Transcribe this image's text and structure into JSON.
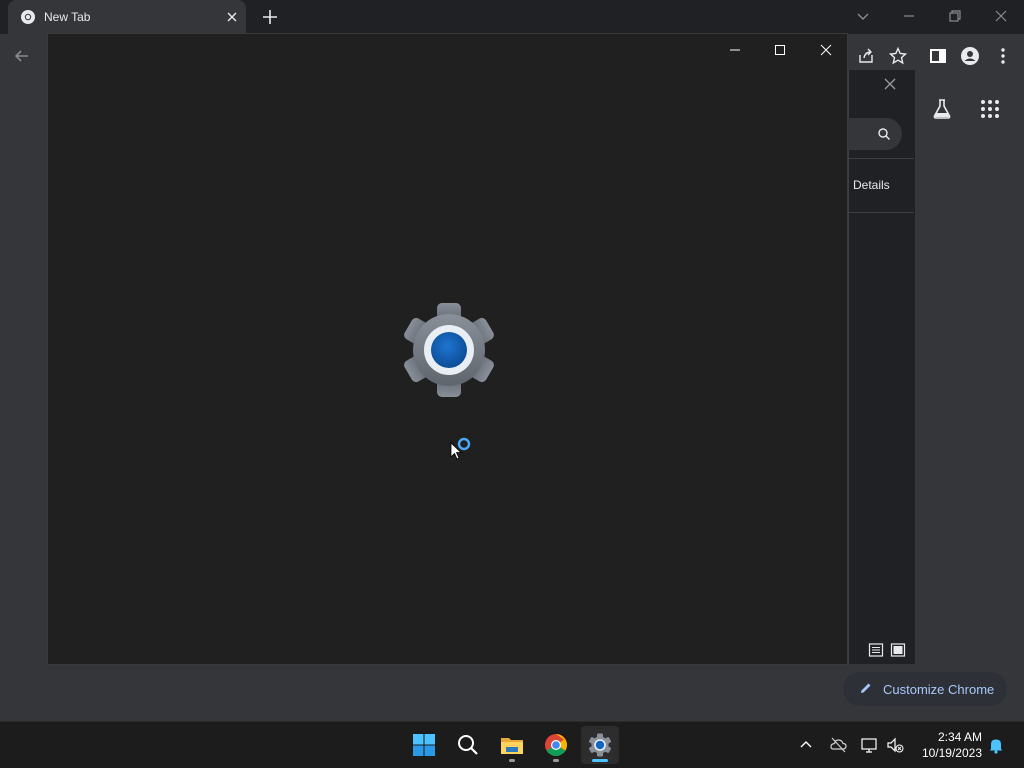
{
  "browser": {
    "tab_title": "New Tab",
    "side_panel": {
      "details_label": "Details"
    },
    "customize_label": "Customize Chrome"
  },
  "taskbar": {
    "apps": [
      {
        "name": "Start",
        "icon": "windows-start-icon"
      },
      {
        "name": "Search",
        "icon": "search-icon"
      },
      {
        "name": "File Explorer",
        "icon": "folder-icon"
      },
      {
        "name": "Google Chrome",
        "icon": "chrome-icon"
      },
      {
        "name": "Settings",
        "icon": "gear-icon"
      }
    ],
    "clock": {
      "time": "2:34 AM",
      "date": "10/19/2023"
    }
  },
  "colors": {
    "accent": "#4cc2ff",
    "settings_blue": "#1565c0",
    "chrome_dark": "#35363a"
  }
}
